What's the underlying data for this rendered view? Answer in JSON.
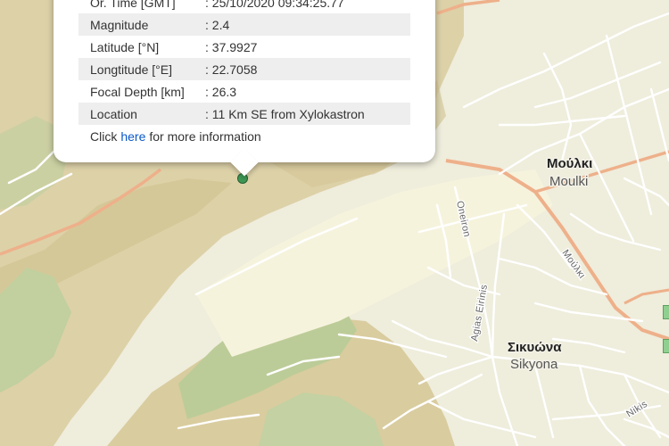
{
  "popup": {
    "rows": [
      {
        "label": "Or. Time [GMT]",
        "value": ": 25/10/2020 09:34:25.77"
      },
      {
        "label": "Magnitude",
        "value": ": 2.4"
      },
      {
        "label": "Latitude [°N]",
        "value": ": 37.9927"
      },
      {
        "label": "Longtitude [°E]",
        "value": ": 22.7058"
      },
      {
        "label": "Focal Depth [km]",
        "value": ": 26.3"
      },
      {
        "label": "Location",
        "value": ": 11 Km SE from Xylokastron"
      }
    ],
    "more_prefix": "Click",
    "more_link": "here",
    "more_suffix": "for more information"
  },
  "map": {
    "places": [
      {
        "name_gr": "Μούλκι",
        "name_en": "Moulki"
      },
      {
        "name_gr": "Σικυώνα",
        "name_en": "Sikyona"
      }
    ],
    "streets": {
      "oneiron": "Oneiron",
      "agias_eirinis": "Agias Eirinis",
      "moulki_road": "Μούλκι",
      "nikis": "Nikis"
    }
  },
  "colors": {
    "marker": "#3f9a55",
    "plain": "#f1efdf",
    "hills": "#dccfa6",
    "forest": "#bfcf9d",
    "main_road": "#f0b38f"
  }
}
